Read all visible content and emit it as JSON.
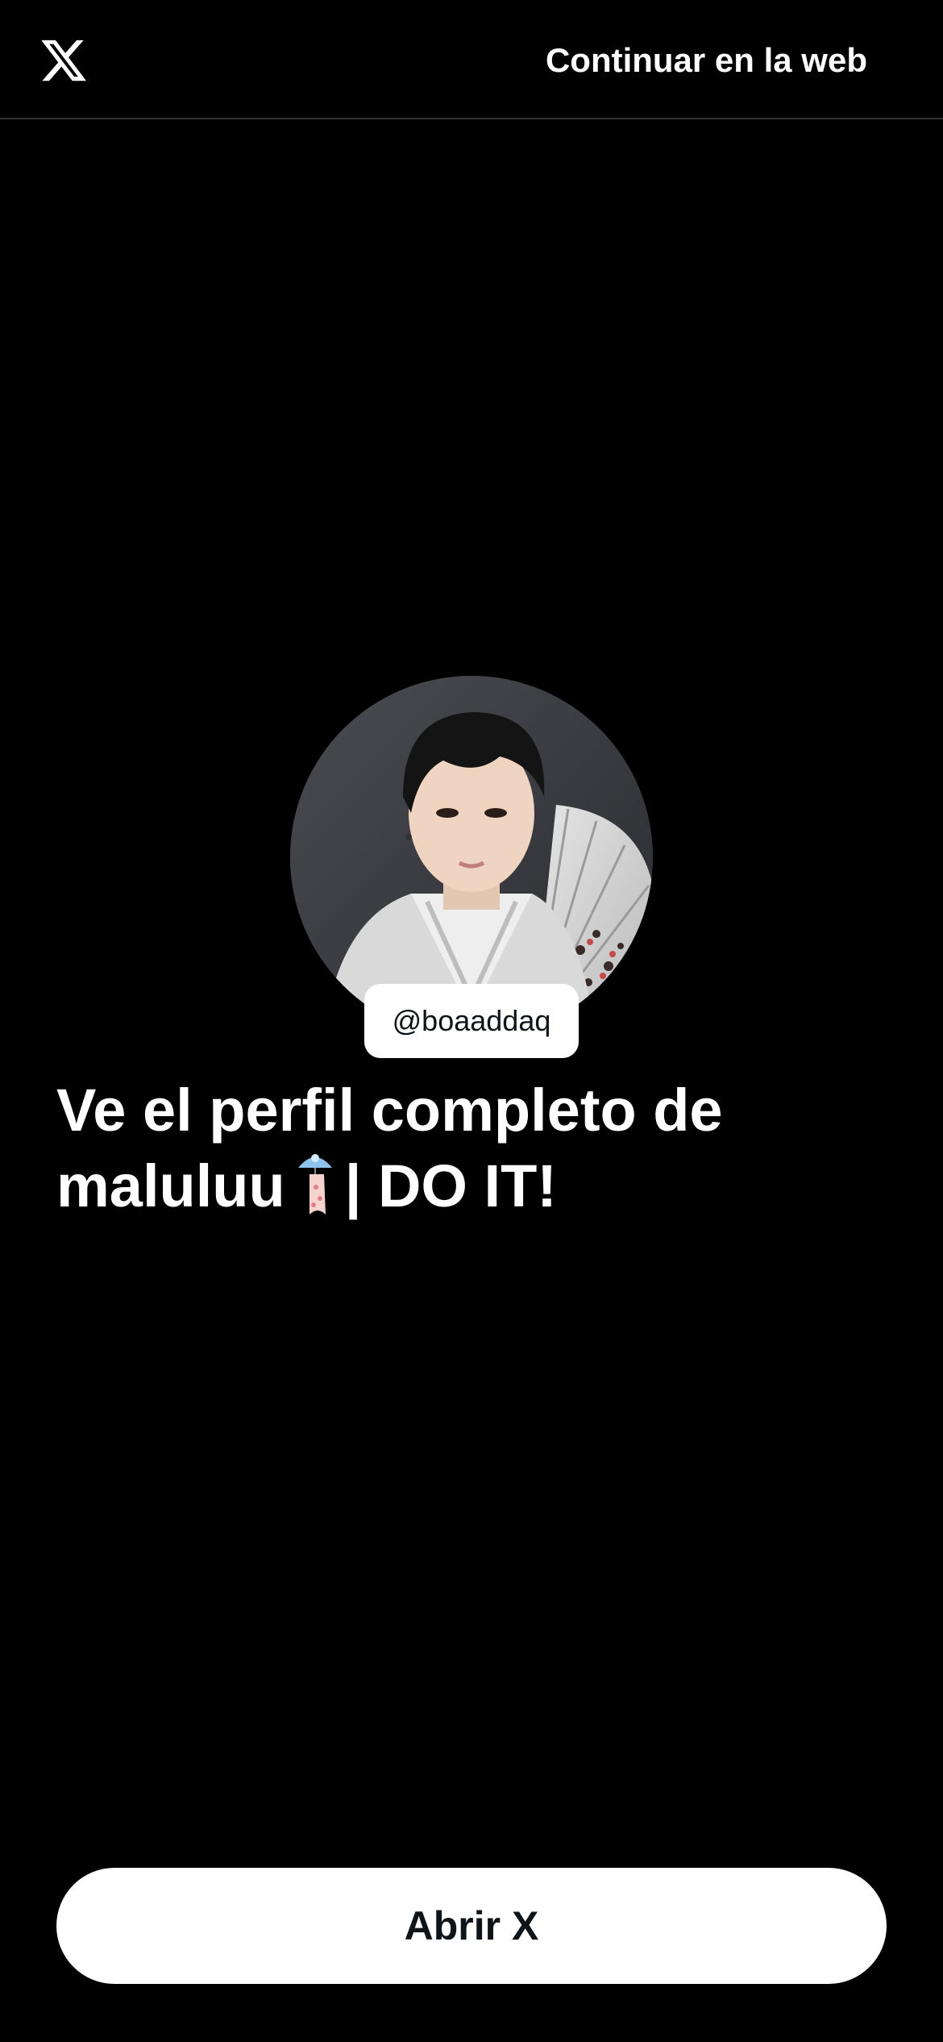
{
  "header": {
    "logo_icon": "x-logo-icon",
    "continue_label": "Continuar en la web"
  },
  "profile": {
    "avatar_description_icon": "profile-avatar",
    "handle": "@boaaddaq",
    "headline_line1": "Ve el perfil completo de",
    "headline_name": "malulu​u",
    "headline_suffix": "| DO IT!",
    "emoji_icon": "wind-chime-icon"
  },
  "footer": {
    "open_button_label": "Abrir X"
  },
  "colors": {
    "background": "#000000",
    "text_primary": "#ffffff",
    "button_bg": "#ffffff",
    "button_text": "#0f1419",
    "divider": "#2f3336"
  }
}
